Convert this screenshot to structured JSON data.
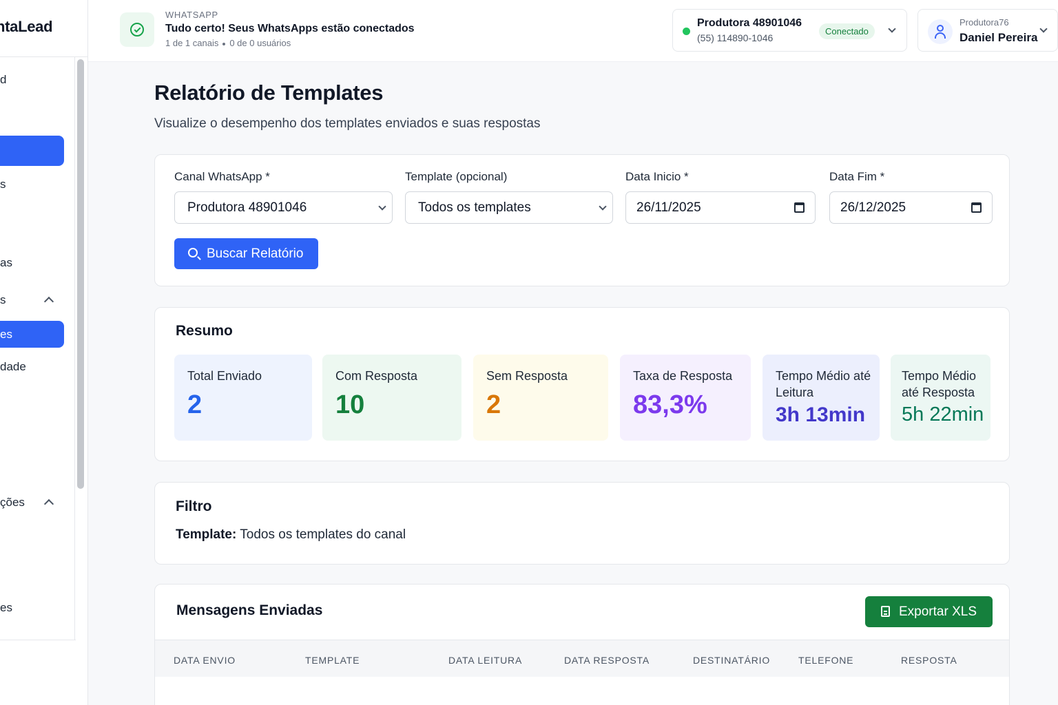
{
  "app": {
    "logo_text": "ntaLead"
  },
  "sidebar": {
    "items": [
      {
        "label": "d"
      },
      {
        "label": ""
      },
      {
        "label": "s"
      },
      {
        "label": "as"
      },
      {
        "label": "s"
      },
      {
        "label": "es"
      },
      {
        "label": "dade"
      },
      {
        "label": "ções"
      },
      {
        "label": "es"
      }
    ]
  },
  "header": {
    "whatsapp_label": "WHATSAPP",
    "status_title": "Tudo certo! Seus WhatsApps estão conectados",
    "channels_count": "1 de 1 canais",
    "users_count": "0 de 0 usuários",
    "channel": {
      "name": "Produtora 48901046",
      "phone": "(55) 114890-1046",
      "status": "Conectado"
    },
    "user": {
      "company": "Produtora76",
      "name": "Daniel Pereira"
    }
  },
  "page": {
    "title": "Relatório de Templates",
    "subtitle": "Visualize o desempenho dos templates enviados e suas respostas"
  },
  "filters": {
    "channel": {
      "label": "Canal WhatsApp *",
      "value": "Produtora 48901046"
    },
    "template": {
      "label": "Template (opcional)",
      "value": "Todos os templates"
    },
    "start_date": {
      "label": "Data Inicio *",
      "value": "26/11/2025"
    },
    "end_date": {
      "label": "Data Fim *",
      "value": "26/12/2025"
    },
    "search_button": "Buscar Relatório"
  },
  "summary": {
    "title": "Resumo",
    "stats": [
      {
        "label": "Total Enviado",
        "value": "2",
        "color": "#2563eb"
      },
      {
        "label": "Com Resposta",
        "value": "10",
        "color": "#15803d"
      },
      {
        "label": "Sem Resposta",
        "value": "2",
        "color": "#d97706"
      },
      {
        "label": "Taxa de Resposta",
        "value": "83,3%",
        "color": "#7c3aed"
      },
      {
        "label": "Tempo Médio até Leitura",
        "value": "3h 13min",
        "color": "#4338ca"
      },
      {
        "label": "Tempo Médio até Resposta",
        "value": "5h 22min",
        "color": "#047857"
      }
    ]
  },
  "filter_info": {
    "title": "Filtro",
    "template_label": "Template:",
    "template_value": "Todos os templates do canal"
  },
  "messages": {
    "title": "Mensagens Enviadas",
    "export_button": "Exportar XLS",
    "columns": [
      "DATA ENVIO",
      "TEMPLATE",
      "DATA LEITURA",
      "DATA  RESPOSTA",
      "DESTINATÁRIO",
      "TELEFONE",
      "RESPOSTA"
    ]
  }
}
